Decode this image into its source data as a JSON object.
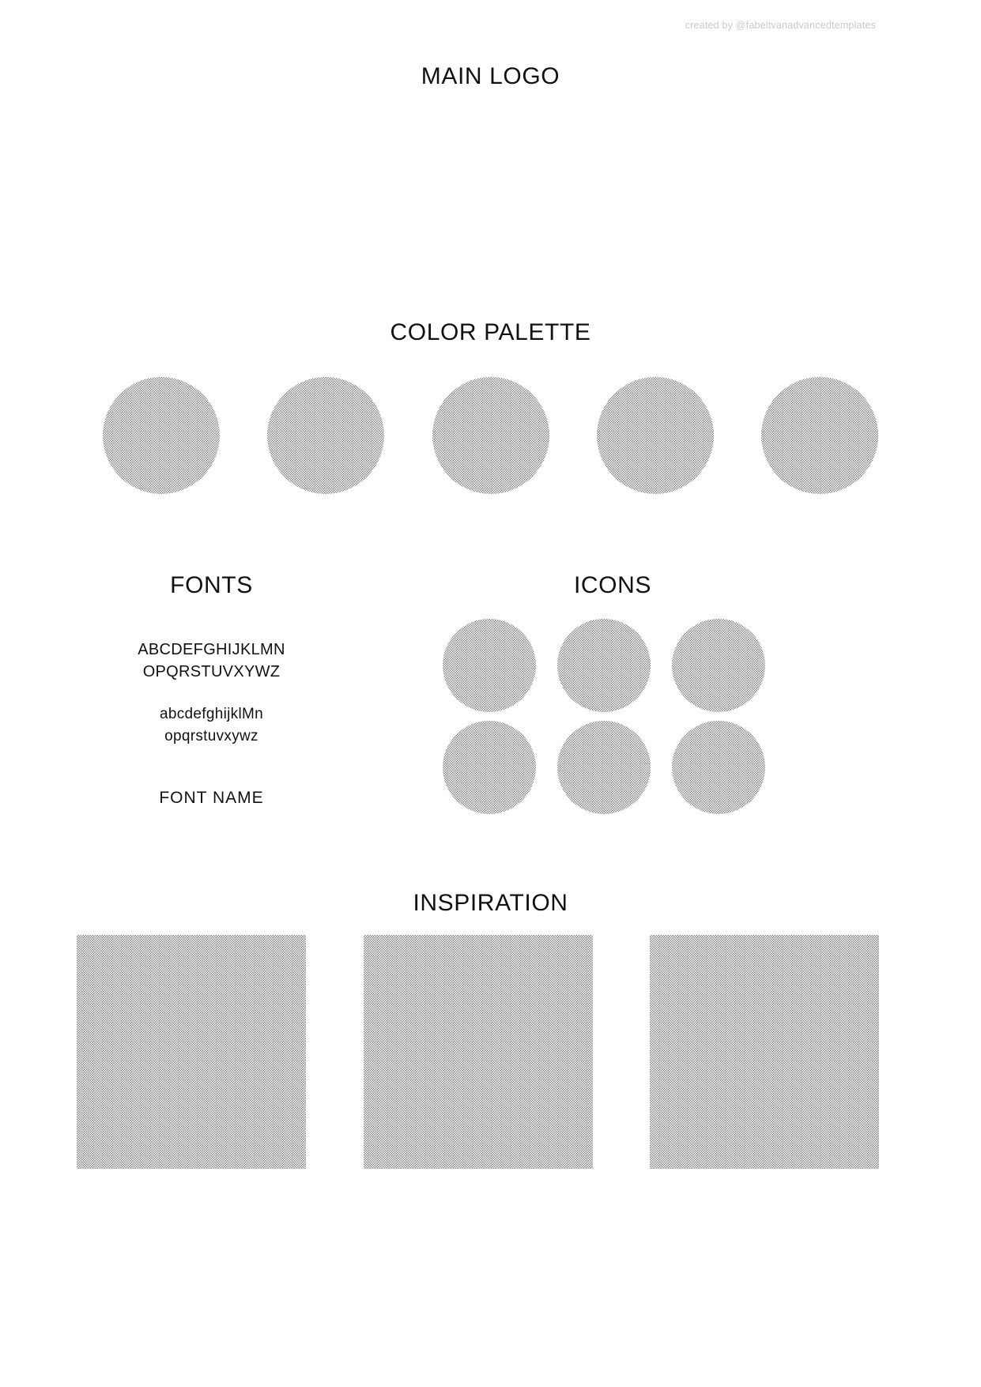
{
  "meta": {
    "credit": "created by @fabeltvanadvancedtemplates",
    "background_color": "#ffffff",
    "text_color": "#111111",
    "placeholder_color": "#b0b0b0"
  },
  "sections": {
    "main_logo": {
      "heading": "MAIN LOGO"
    },
    "color_palette": {
      "heading": "COLOR PALETTE",
      "swatches": [
        {
          "name": "swatch-1",
          "color": "#b0b0b0"
        },
        {
          "name": "swatch-2",
          "color": "#b0b0b0"
        },
        {
          "name": "swatch-3",
          "color": "#b0b0b0"
        },
        {
          "name": "swatch-4",
          "color": "#b0b0b0"
        },
        {
          "name": "swatch-5",
          "color": "#b0b0b0"
        }
      ]
    },
    "fonts": {
      "heading": "FONTS",
      "uppercase_lines": [
        "ABCDEFGHIJKLMN",
        "OPQRSTUVXYWZ"
      ],
      "lowercase_lines": [
        "abcdefghijklMn",
        "opqrstuvxywz"
      ],
      "font_name": "FONT NAME"
    },
    "icons": {
      "heading": "ICONS",
      "items": [
        {
          "label": "icon-placeholder-1"
        },
        {
          "label": "icon-placeholder-2"
        },
        {
          "label": "icon-placeholder-3"
        },
        {
          "label": "icon-placeholder-4"
        },
        {
          "label": "icon-placeholder-5"
        },
        {
          "label": "icon-placeholder-6"
        }
      ]
    },
    "inspiration": {
      "heading": "INSPIRATION",
      "items": [
        {
          "label": "inspiration-image-1"
        },
        {
          "label": "inspiration-image-2"
        },
        {
          "label": "inspiration-image-3"
        }
      ]
    }
  }
}
